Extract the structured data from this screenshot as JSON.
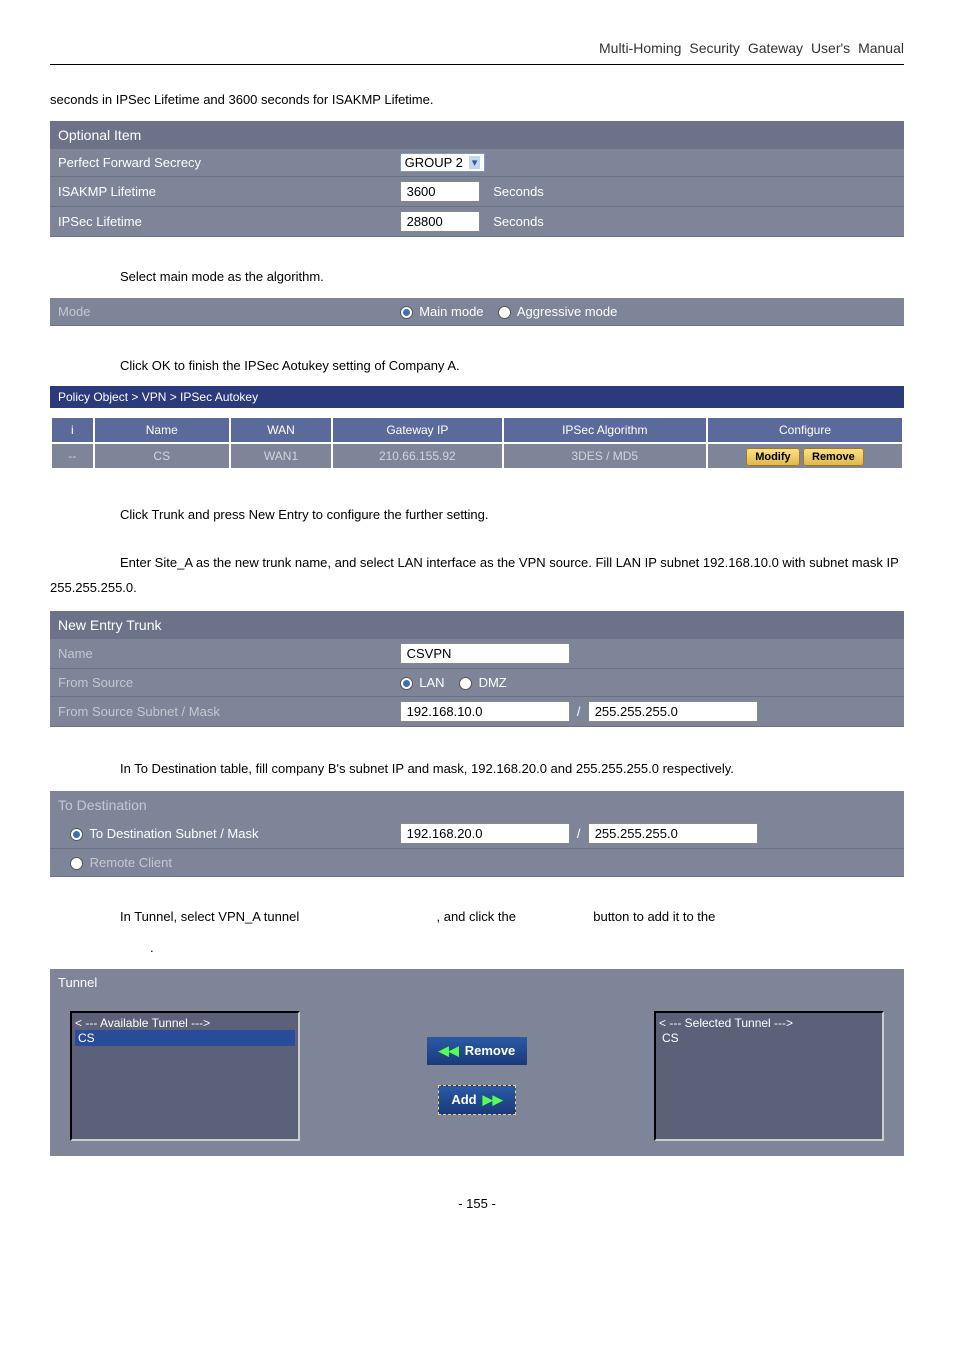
{
  "header": "Multi-Homing  Security  Gateway  User's  Manual",
  "intro_text": "seconds in IPSec Lifetime and 3600 seconds for ISAKMP Lifetime.",
  "optional": {
    "title": "Optional Item",
    "pfs_label": "Perfect Forward Secrecy",
    "pfs_value": "GROUP 2",
    "isakmp_label": "ISAKMP Lifetime",
    "isakmp_value": "3600",
    "isakmp_unit": "Seconds",
    "ipsec_label": "IPSec Lifetime",
    "ipsec_value": "28800",
    "ipsec_unit": "Seconds"
  },
  "mode": {
    "instruction": "Select main mode as the algorithm.",
    "label": "Mode",
    "main": "Main mode",
    "aggressive": "Aggressive mode"
  },
  "ok_instruction": "Click OK to finish the IPSec Aotukey setting of Company A.",
  "breadcrumb": "Policy Object > VPN > IPSec Autokey",
  "autokey": {
    "headers": {
      "i": "i",
      "name": "Name",
      "wan": "WAN",
      "gateway": "Gateway IP",
      "algo": "IPSec Algorithm",
      "conf": "Configure"
    },
    "row": {
      "i": "--",
      "name": "CS",
      "wan": "WAN1",
      "gateway": "210.66.155.92",
      "algo": "3DES / MD5"
    },
    "modify": "Modify",
    "remove": "Remove"
  },
  "trunk_click": "Click Trunk and press New Entry to configure the further setting.",
  "trunk_enter": "Enter Site_A as the new trunk name, and select LAN interface as the VPN source. Fill LAN IP subnet 192.168.10.0 with subnet mask IP 255.255.255.0.",
  "trunk": {
    "title": "New Entry Trunk",
    "name_label": "Name",
    "name_value": "CSVPN",
    "source_label": "From Source",
    "source_lan": "LAN",
    "source_dmz": "DMZ",
    "subnet_label": "From Source Subnet / Mask",
    "subnet_ip": "192.168.10.0",
    "subnet_mask": "255.255.255.0",
    "slash": "/"
  },
  "dest_instruction": "In To Destination table, fill company B's subnet IP and mask, 192.168.20.0 and 255.255.255.0 respectively.",
  "dest": {
    "title": "To Destination",
    "subnet_label": "To Destination Subnet / Mask",
    "subnet_ip": "192.168.20.0",
    "subnet_mask": "255.255.255.0",
    "slash": "/",
    "remote_label": "Remote Client"
  },
  "tunnel_instruction_pre": "In Tunnel, select VPN_A tunnel",
  "tunnel_instruction_mid": ", and click the",
  "tunnel_instruction_post": "button to add it to the",
  "tunnel_dot": ".",
  "tunnel": {
    "title": "Tunnel",
    "available_header": "< --- Available Tunnel --->",
    "selected_header": "< --- Selected Tunnel --->",
    "item": "CS",
    "remove": "Remove",
    "add": "Add"
  },
  "page_number": "- 155 -"
}
